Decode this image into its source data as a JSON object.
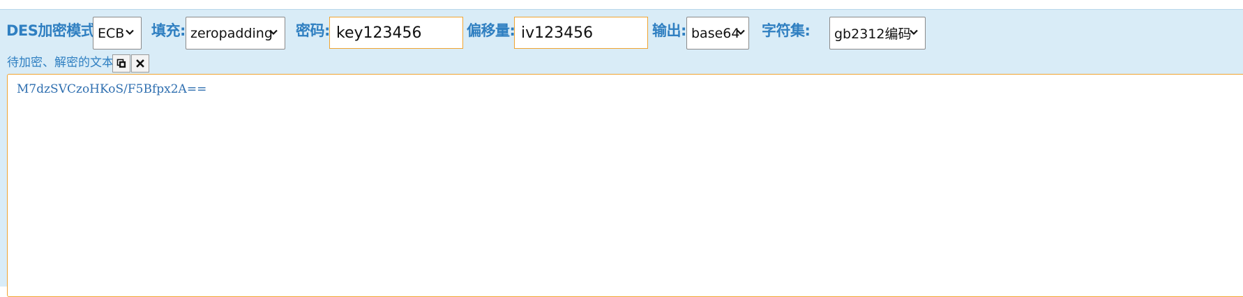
{
  "toolbar": {
    "mode_label": "DES加密模式:",
    "mode_value": "ECB",
    "padding_label": "填充:",
    "padding_value": "zeropadding",
    "password_label": "密码:",
    "password_value": "key123456",
    "offset_label": "偏移量:",
    "offset_value": "iv123456",
    "output_label": "输出:",
    "output_value": "base64",
    "charset_label": "字符集:",
    "charset_value": "gb2312编码"
  },
  "text_section": {
    "label": "待加密、解密的文本:",
    "copy_icon": "copy-icon",
    "clear_icon": "close-icon",
    "content": "M7dzSVCzoHKoS/F5Bfpx2A=="
  },
  "colors": {
    "accent": "#2f7fc1",
    "panel_bg": "#d9ecf7",
    "input_border": "#f0a330"
  }
}
